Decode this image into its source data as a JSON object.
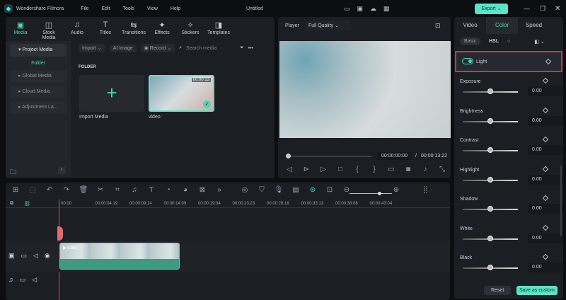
{
  "app": {
    "name": "Wondershare Filmora",
    "doc_title": "Untitled",
    "export_label": "Export"
  },
  "menu": [
    "File",
    "Edit",
    "Tools",
    "View",
    "Help"
  ],
  "nav_tabs": [
    {
      "label": "Media",
      "icon": "media-icon"
    },
    {
      "label": "Stock Media",
      "icon": "stock-icon"
    },
    {
      "label": "Audio",
      "icon": "music-icon"
    },
    {
      "label": "Titles",
      "icon": "titles-icon"
    },
    {
      "label": "Transitions",
      "icon": "transitions-icon"
    },
    {
      "label": "Effects",
      "icon": "effects-icon"
    },
    {
      "label": "Stickers",
      "icon": "stickers-icon"
    },
    {
      "label": "Templates",
      "icon": "templates-icon"
    }
  ],
  "media": {
    "import": "Import",
    "ai_image": "AI Image",
    "record": "Record",
    "search_placeholder": "Search media",
    "folder_heading": "FOLDER",
    "import_media": "Import Media",
    "clip_name": "video",
    "clip_duration": "00:00:13"
  },
  "sidebar": {
    "project_media": "Project Media",
    "folder": "Folder",
    "items": [
      "Global Media",
      "Cloud Media",
      "Adjustment La..."
    ]
  },
  "player": {
    "label": "Player",
    "quality": "Full Quality",
    "current": "00:00:00:00",
    "separator": "/",
    "total": "00:00:13:22"
  },
  "timeline": {
    "ticks": [
      "00:00",
      "00:00:04:19",
      "00:00:09:14",
      "00:00:14:09",
      "00:00:19:04",
      "00:00:23:23",
      "00:00:28:18",
      "00:00:33:13",
      "00:00:38:08",
      "00:00:43:04"
    ],
    "clip_label": "video",
    "zoom_level": 0.7
  },
  "right": {
    "tabs": [
      "Video",
      "Color",
      "Speed"
    ],
    "subtabs": [
      "Basic",
      "HSL"
    ],
    "light_label": "Light",
    "sliders": [
      {
        "label": "Exposure",
        "value": "0.00"
      },
      {
        "label": "Brightness",
        "value": "0.00"
      },
      {
        "label": "Contrast",
        "value": "0.00"
      },
      {
        "label": "Highlight",
        "value": "0.00"
      },
      {
        "label": "Shadow",
        "value": "0.00"
      },
      {
        "label": "White",
        "value": "0.00"
      },
      {
        "label": "Black",
        "value": "0.00"
      }
    ],
    "reset": "Reset",
    "save": "Save as custom"
  },
  "colors": {
    "accent": "#4fd6b5",
    "highlight_box": "#d9313a"
  }
}
